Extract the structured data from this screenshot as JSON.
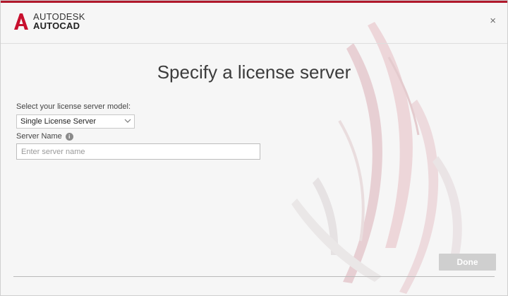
{
  "app": {
    "brand_line1": "AUTODESK",
    "brand_line2": "AUTOCAD",
    "brand_color": "#c8102e"
  },
  "header": {
    "close_glyph": "×",
    "close_icon": "close-icon"
  },
  "main": {
    "title": "Specify a license server",
    "model_label": "Select your license server model:",
    "model_selected": "Single License Server",
    "server_name_label": "Server Name",
    "info_icon": "info-icon",
    "info_glyph": "i",
    "server_name_value": "",
    "server_name_placeholder": "Enter server name"
  },
  "footer": {
    "done_label": "Done",
    "done_disabled_color": "#cfcfcf"
  }
}
